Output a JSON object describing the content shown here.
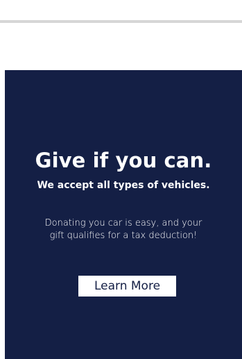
{
  "ad": {
    "headline": "Give if you can.",
    "subhead": "We accept all types of vehicles.",
    "body": "Donating you car is easy, and your gift qualifies for a tax deduction!",
    "cta_label": "Learn More"
  },
  "colors": {
    "panel_background": "#141f45",
    "text": "#ffffff",
    "button_background": "#ffffff",
    "button_text": "#141f45",
    "divider": "#d6d6d6"
  }
}
